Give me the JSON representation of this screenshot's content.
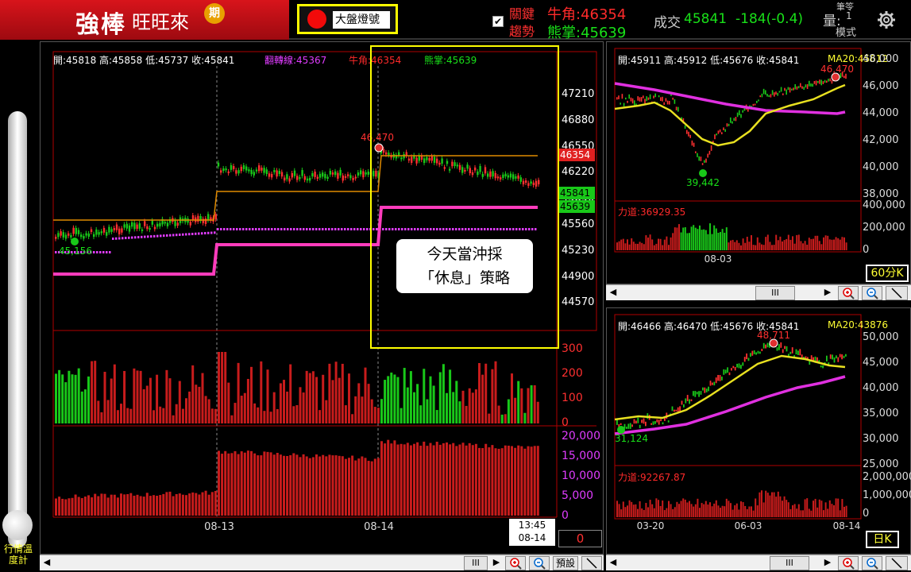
{
  "app": {
    "brand": "強棒",
    "subtitle": "旺旺來",
    "badge": "期"
  },
  "signal": {
    "label": "大盤燈號",
    "color": "#f20a0a"
  },
  "header": {
    "key_label_1": "關鍵",
    "key_label_2": "趨勢",
    "bull_label": "牛角:46354",
    "bear_label": "熊掌:45639",
    "trade_label": "成交",
    "trade_value": "45841",
    "trade_change": "-184(-0.4)",
    "qty_label": "量:",
    "qty_top": "筆",
    "qty_mode": "1",
    "mode_label": "模式",
    "mode_top": "筆笭"
  },
  "thermo": {
    "label": "行情溫度計"
  },
  "main_chart": {
    "info": {
      "open": "開:45818",
      "high": "高:45858",
      "low": "低:45737",
      "close": "收:45841",
      "reversal": "翻轉線:45367",
      "bull": "牛角:46354",
      "bear": "熊掌:45639"
    },
    "price_ticks": [
      "47210",
      "46880",
      "46550",
      "46220",
      "45890",
      "45560",
      "45230",
      "44900",
      "44570"
    ],
    "price_tags": {
      "bull": "46354",
      "last": "45841",
      "bear": "45639"
    },
    "peak_label": "46,470",
    "trough_label": "45,156",
    "vol_ticks": [
      "300",
      "200",
      "100",
      "0"
    ],
    "oi_ticks": [
      "20,000",
      "15,000",
      "10,000",
      "5,000",
      "0"
    ],
    "dates": [
      "08-13",
      "08-14"
    ],
    "cursor_time": "13:45",
    "cursor_date": "08-14",
    "counter": "0",
    "annotation_line1": "今天當沖採",
    "annotation_line2": "「休息」策略",
    "chart_data": {
      "type": "line",
      "title": "",
      "series": [
        {
          "name": "牛角",
          "values": [
            46354
          ]
        },
        {
          "name": "熊掌",
          "values": [
            45639
          ]
        }
      ],
      "ylim": [
        44400,
        47400
      ]
    }
  },
  "right_top": {
    "info": {
      "open": "開:45911",
      "high": "高:45912",
      "low": "低:45676",
      "close": "收:45841",
      "ma": "MA20:45612"
    },
    "price_ticks": [
      "48,000",
      "46,000",
      "44,000",
      "42,000",
      "40,000",
      "38,000"
    ],
    "vol_label": "力道:36929.35",
    "vol_ticks": [
      "400,000",
      "200,000",
      "0"
    ],
    "peak_label": "46,470",
    "trough_label": "39,442",
    "date": "08-03",
    "period": "60分K"
  },
  "right_bottom": {
    "info": {
      "open": "開:46466",
      "high": "高:46470",
      "low": "低:45676",
      "close": "收:45841",
      "ma": "MA20:43876"
    },
    "price_ticks": [
      "50,000",
      "45,000",
      "40,000",
      "35,000",
      "30,000",
      "25,000"
    ],
    "vol_label": "力道:92267.87",
    "vol_ticks": [
      "2,000,000",
      "1,000,000",
      "0"
    ],
    "peak_label": "48,711",
    "trough_label": "31,124",
    "dates": [
      "03-20",
      "06-03",
      "08-14"
    ],
    "period": "日K"
  },
  "toolbar": {
    "preset": "預設",
    "scroll_mark": "III"
  }
}
